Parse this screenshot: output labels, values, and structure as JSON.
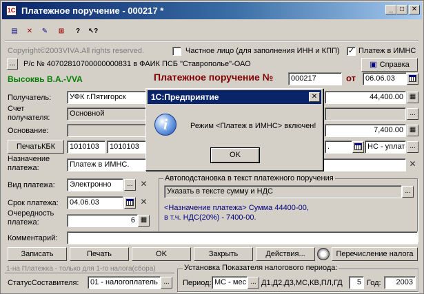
{
  "window": {
    "title": "Платежное поручение - 000217 *",
    "app_icon": "1c-icon"
  },
  "toolbar": [
    "doc-icon",
    "delete-icon",
    "edit-icon",
    "struct-icon",
    "help-icon",
    "pointer-help-icon"
  ],
  "copyright": "Copyright©2003VIVA.All rights reserved.",
  "private_person": {
    "label": "Частное лицо (для заполнения ИНН и КПП)",
    "checked": ""
  },
  "imns_payment": {
    "label": "Платеж в ИМНС",
    "checked": "✓"
  },
  "account_line": "Р/с № 40702810700000000831 в ФАИК ПСБ \"Ставрополье\"-ОАО",
  "help_button": "Справка",
  "author": "Высоквь В.А.-VVA",
  "doc": {
    "title": "Платежное поручение №",
    "number": "000217",
    "from_label": "от",
    "date": "06.06.03"
  },
  "recipient": {
    "label": "Получатель:",
    "value": "УФК г.Пятигорск",
    "amount": "44,400.00"
  },
  "account": {
    "label": "Счет получателя:",
    "value": "Основной"
  },
  "basis": {
    "label": "Основание:",
    "value": "",
    "amount": "7,400.00"
  },
  "kbk": {
    "button": "ПечатьКБК",
    "code1": "1010103",
    "code2": "1010103",
    "nds_value": "НС - уплата"
  },
  "purpose": {
    "label": "Назначение платежа:",
    "value": "Платеж в ИМНС."
  },
  "auto_group": {
    "title": "Автоподстановка в текст платежного поручения",
    "select": "Указать в тексте сумму и НДС",
    "preview_line1": "<Назначение платежа> Сумма 44400-00,",
    "preview_line2": "в т.ч. НДС(20%) - 7400-00."
  },
  "payment_type": {
    "label": "Вид платежа:",
    "value": "Электронно"
  },
  "due_date": {
    "label": "Срок платежа:",
    "value": "04.06.03"
  },
  "priority": {
    "label": "Очередность платежа:",
    "value": "6"
  },
  "comment": {
    "label": "Комментарий:",
    "value": ""
  },
  "buttons": {
    "save": "Записать",
    "print": "Печать",
    "ok": "OK",
    "close": "Закрыть",
    "actions": "Действия...",
    "tax_transfer": "Перечисление налога"
  },
  "footer": {
    "note": "1-на Платежка - только для 1-го налога(сбора)",
    "status_label": "СтатусСоставителя:",
    "status_value": "01 - налогоплатель",
    "period_group": "Установка Показателя налогового периода:",
    "period_label": "Период:",
    "period_value": "МС - мес",
    "period_codes": "Д1,Д2,Д3,МС,КВ,ПЛ,ГД",
    "period_num": "5",
    "year_label": "Год:",
    "year_value": "2003"
  },
  "dialog": {
    "title": "1С:Предприятие",
    "icon": "info-icon",
    "message": "Режим <Платеж в ИМНС> включен!",
    "ok": "OK"
  },
  "colors": {
    "title_active": "#0a246a",
    "doc_title": "#800000",
    "author": "#008000",
    "link_blue": "#000080"
  }
}
